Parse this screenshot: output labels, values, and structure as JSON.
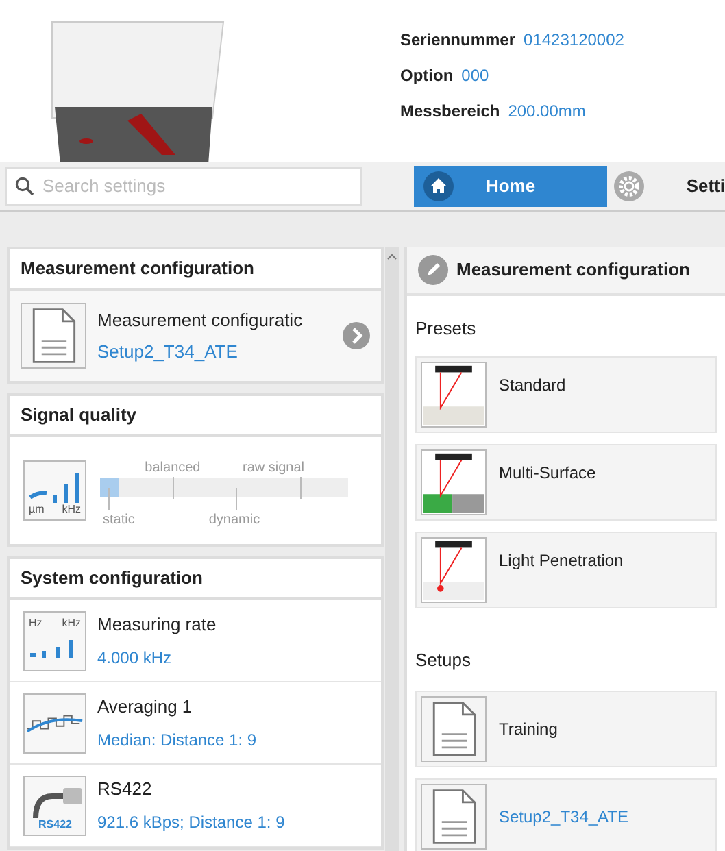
{
  "device": {
    "fields": [
      {
        "label": "Seriennummer",
        "value": "01423120002"
      },
      {
        "label": "Option",
        "value": "000"
      },
      {
        "label": "Messbereich",
        "value": "200.00mm"
      }
    ]
  },
  "search": {
    "placeholder": "Search settings"
  },
  "nav": [
    {
      "label": "Home",
      "selected": true,
      "kind": "home"
    },
    {
      "label": "Setti",
      "selected": false,
      "kind": "settings"
    }
  ],
  "left": {
    "measurement": {
      "title": "Measurement configuration",
      "item": {
        "name": "Measurement configuratic",
        "value": "Setup2_T34_ATE"
      }
    },
    "signal": {
      "title": "Signal quality",
      "icon_text": [
        "µm",
        "kHz"
      ],
      "level": 0,
      "stops": [
        "static",
        "balanced",
        "dynamic",
        "raw signal"
      ]
    },
    "system": {
      "title": "System configuration",
      "rows": [
        {
          "kind": "rate",
          "icon_text": [
            "Hz",
            "kHz"
          ],
          "name": "Measuring rate",
          "value": "4.000 kHz"
        },
        {
          "kind": "averaging",
          "icon_text": [],
          "name": "Averaging 1",
          "value": "Median: Distance 1: 9"
        },
        {
          "kind": "interface",
          "icon_text": [
            "RS422"
          ],
          "name": "RS422",
          "value": "921.6 kBps; Distance 1: 9"
        }
      ]
    }
  },
  "right": {
    "title": "Measurement configuration",
    "presets_label": "Presets",
    "presets": [
      {
        "kind": "standard",
        "label": "Standard"
      },
      {
        "kind": "multi",
        "label": "Multi-Surface"
      },
      {
        "kind": "penetration",
        "label": "Light Penetration"
      }
    ],
    "setups_label": "Setups",
    "setups": [
      {
        "label": "Training",
        "active": false
      },
      {
        "label": "Setup2_T34_ATE",
        "active": true
      }
    ]
  }
}
